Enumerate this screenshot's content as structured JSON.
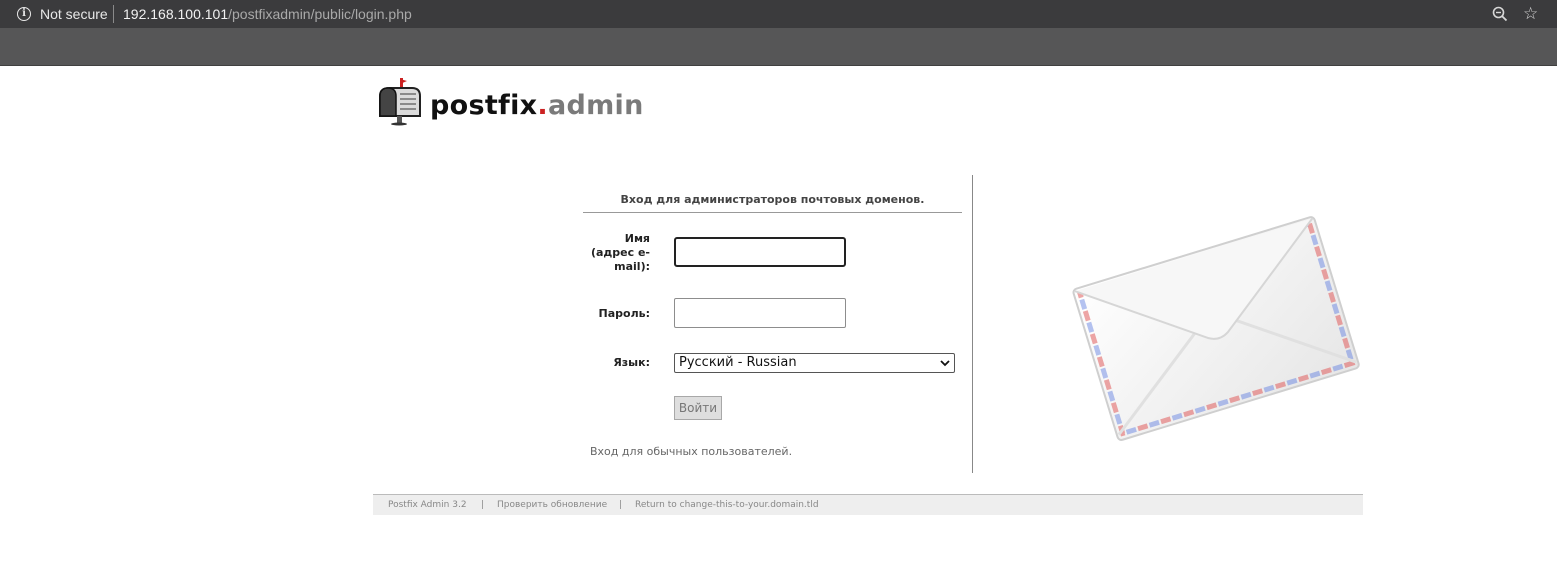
{
  "browser": {
    "security_label": "Not secure",
    "url_host": "192.168.100.101",
    "url_path": "/postfixadmin/public/login.php",
    "icons": [
      "info-icon",
      "zoom-icon",
      "bookmark-star-icon"
    ]
  },
  "logo": {
    "part1": "postfix",
    "part2": ".",
    "part3": "admin"
  },
  "login": {
    "title": "Вход для администраторов почтовых доменов.",
    "username_label": "Имя (адрес e-mail):",
    "username_value": "",
    "password_label": "Пароль:",
    "password_value": "",
    "language_label": "Язык:",
    "language_selected": "Русский - Russian",
    "submit_label": "Войти",
    "user_login_link": "Вход для обычных пользователей."
  },
  "footer": {
    "version": "Postfix Admin 3.2",
    "sep1": "|",
    "check_update": "Проверить обновление",
    "sep2": "|",
    "return_link": "Return to change-this-to-your.domain.tld"
  },
  "colors": {
    "logo_dot": "#cc2222",
    "logo_admin": "#7a7a7a",
    "footer_bg": "#eeeeee"
  }
}
